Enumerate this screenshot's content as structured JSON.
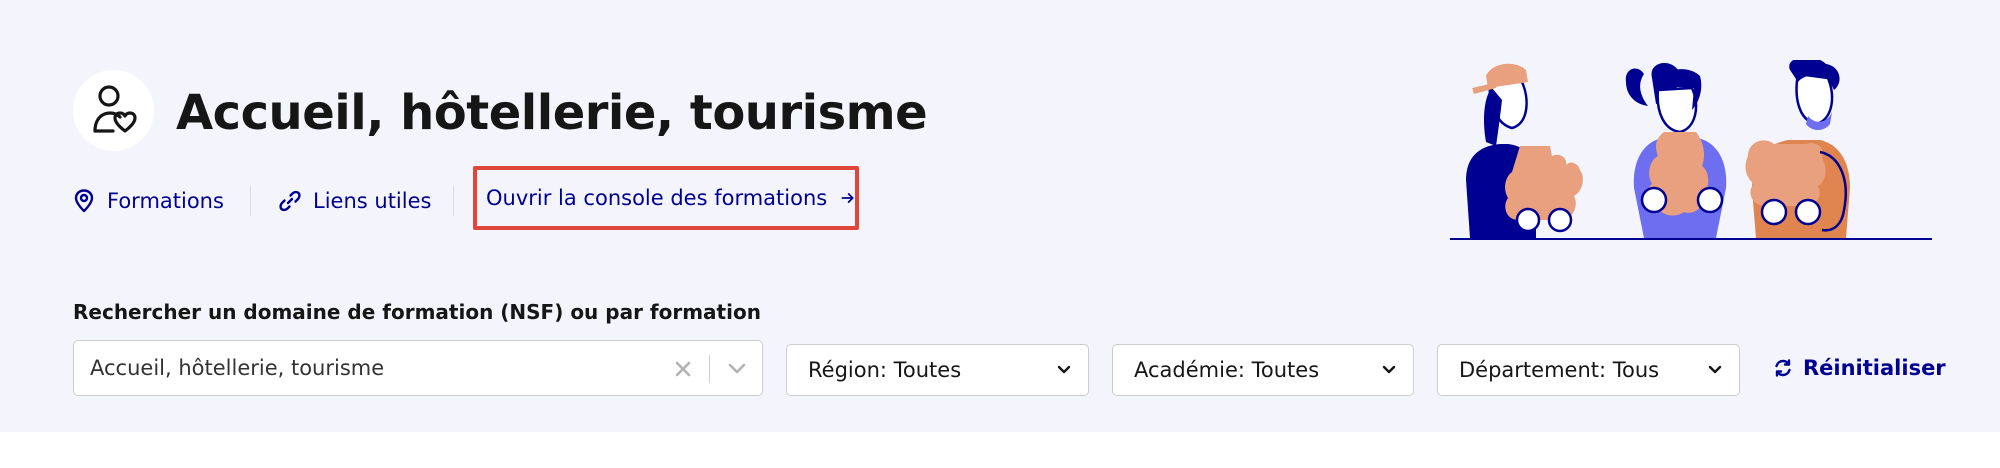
{
  "header": {
    "title": "Accueil, hôtellerie, tourisme",
    "icon": "people-heart-icon"
  },
  "nav": {
    "formations_label": "Formations",
    "liens_label": "Liens utiles",
    "console_label": "Ouvrir la console des formations"
  },
  "search": {
    "label": "Rechercher un domaine de formation (NSF) ou par formation",
    "value": "Accueil, hôtellerie, tourisme"
  },
  "filters": {
    "region": "Région: Toutes",
    "academie": "Académie: Toutes",
    "departement": "Département: Tous"
  },
  "reset_label": "Réinitialiser",
  "colors": {
    "accent": "#000091",
    "hero_bg": "#f4f5fc",
    "highlight_border": "#e1463a",
    "illustration_orange": "#e8a07e",
    "illustration_purple": "#6e6ff0"
  }
}
